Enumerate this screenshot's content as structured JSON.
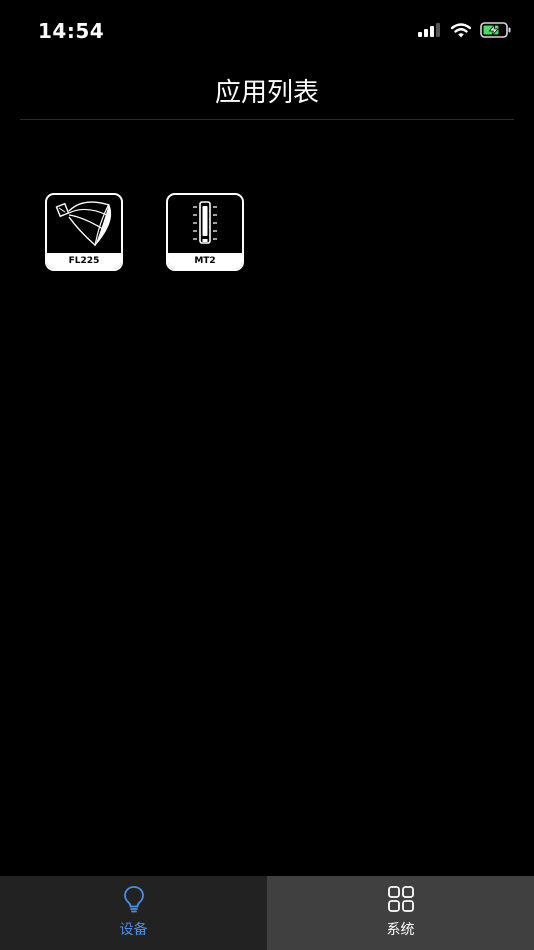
{
  "status_bar": {
    "time": "14:54",
    "icons": [
      "cellular-signal-icon",
      "wifi-icon",
      "battery-charging-icon"
    ]
  },
  "header": {
    "title": "应用列表"
  },
  "apps": [
    {
      "label": "FL225",
      "icon": "parabolic-softbox-icon"
    },
    {
      "label": "MT2",
      "icon": "tube-light-icon"
    }
  ],
  "tab_bar": {
    "tabs": [
      {
        "label": "设备",
        "icon": "lightbulb-icon",
        "active": true
      },
      {
        "label": "系统",
        "icon": "grid-icon",
        "active": false
      }
    ]
  },
  "colors": {
    "background": "#000000",
    "active_tab_text": "#4a90e2",
    "active_tab_bg": "#222222",
    "inactive_tab_bg": "#404040",
    "battery_fill": "#4cd964"
  }
}
